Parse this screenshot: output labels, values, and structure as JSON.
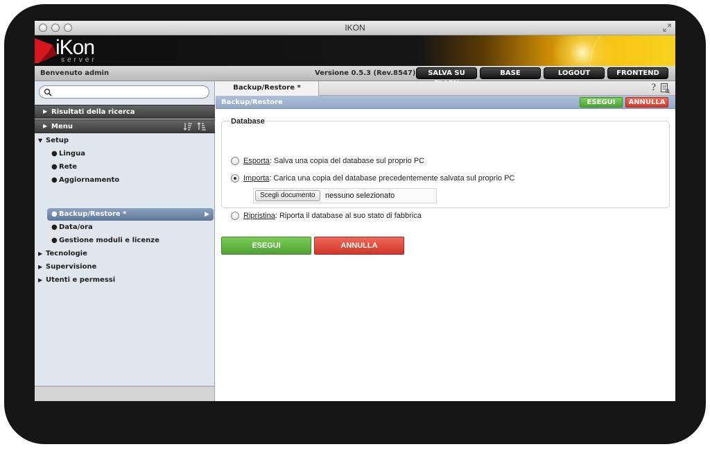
{
  "window": {
    "title": "IKON"
  },
  "logo": {
    "text": "iKon",
    "subtext": "server"
  },
  "toolbar": {
    "welcome": "Benvenuto admin",
    "version": "Versione 0.5.3 (Rev.8547)",
    "buttons": [
      "SALVA SU FLASH",
      "BASE",
      "LOGOUT",
      "FRONTEND"
    ]
  },
  "sidebar": {
    "search": {
      "value": "",
      "placeholder": ""
    },
    "results_label": "Risultati della ricerca",
    "menu_label": "Menu",
    "tree": {
      "setup": "Setup",
      "setup_children": [
        "Lingua",
        "Rete",
        "Aggiornamento",
        "Backup/Restore *",
        "Data/ora",
        "Gestione moduli e licenze"
      ],
      "others": [
        "Tecnologie",
        "Supervisione",
        "Utenti e permessi"
      ]
    }
  },
  "main": {
    "tab_label": "Backup/Restore *",
    "help_label": "?",
    "section_title": "Backup/Restore",
    "top_execute": "ESEGUI",
    "top_cancel": "ANNULLA",
    "fieldset_legend": "Database",
    "options": [
      {
        "link": "Esporta",
        "text": ": Salva una copia del database sul proprio PC",
        "checked": false
      },
      {
        "link": "Importa",
        "text": ": Carica una copia del database precedentemente salvata sul proprio PC",
        "checked": true
      },
      {
        "link": "Ripristina",
        "text": ": Riporta il database al suo stato di fabbrica",
        "checked": false
      }
    ],
    "file": {
      "button": "Scegli documento",
      "status": "nessuno selezionato"
    },
    "execute": "ESEGUI",
    "cancel": "ANNULLA"
  },
  "colors": {
    "accent_green": "#5cb83d",
    "accent_red": "#e04a3a",
    "sidebar_bg": "#dfe6ee",
    "section_bar": "#9fb3cf"
  },
  "icons": [
    "search-icon",
    "sort-asc-icon",
    "sort-desc-icon",
    "help-icon",
    "document-list-icon",
    "resize-icon"
  ]
}
